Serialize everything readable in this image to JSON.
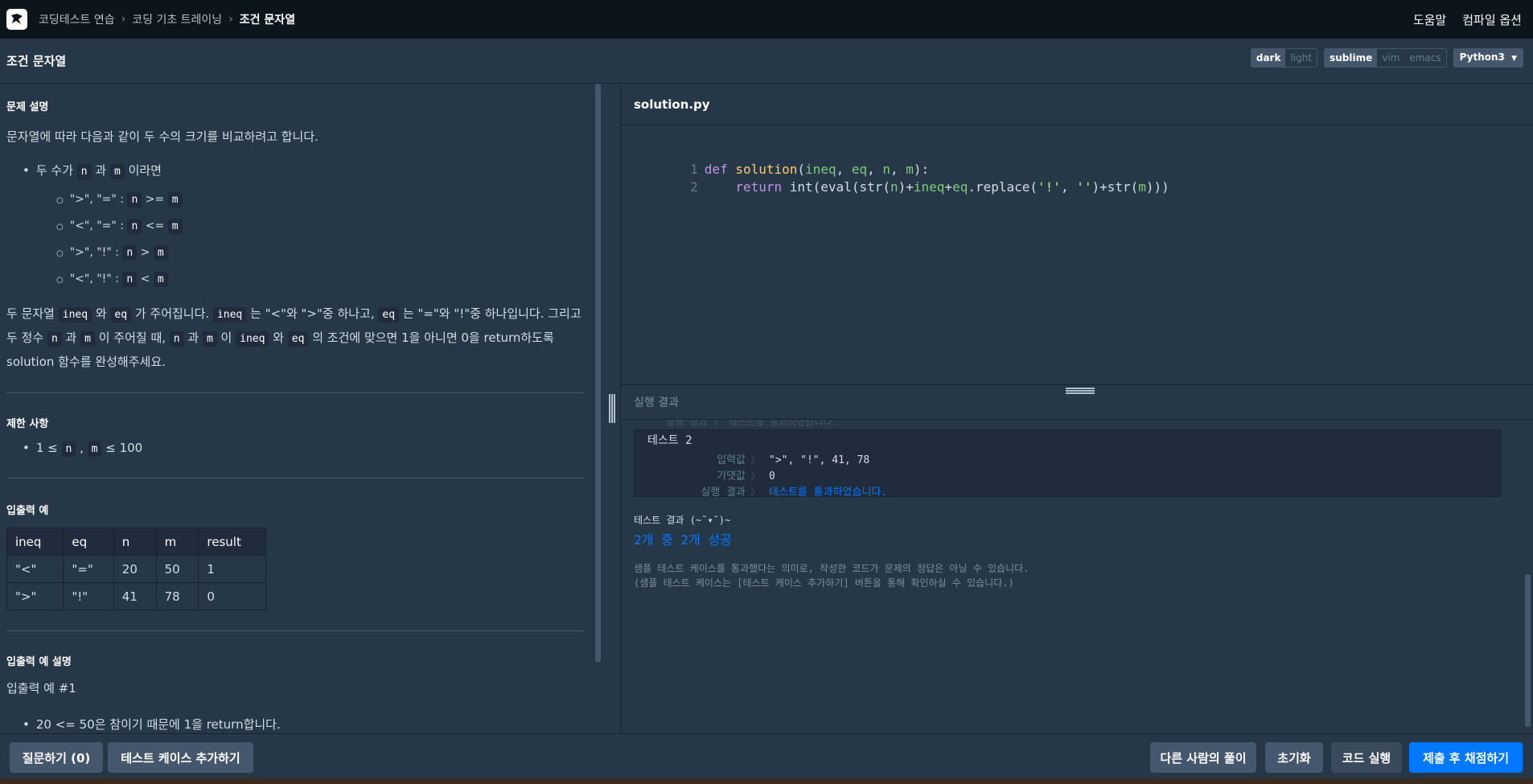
{
  "nav": {
    "crumbs": [
      "코딩테스트 연습",
      "코딩 기초 트레이닝",
      "조건 문자열"
    ],
    "help": "도움말",
    "compile_options": "컴파일 옵션"
  },
  "titlebar": {
    "title": "조건 문자열",
    "theme": {
      "dark": "dark",
      "light": "light"
    },
    "keymap": {
      "sublime": "sublime",
      "vim": "vim",
      "emacs": "emacs"
    },
    "language": "Python3"
  },
  "problem": {
    "desc_heading": "문제 설명",
    "intro": "문자열에 따라 다음과 같이 두 수의 크기를 비교하려고 합니다.",
    "bullet_pre": "두 수가 ",
    "bullet_n": "n",
    "bullet_mid": " 과 ",
    "bullet_m": "m",
    "bullet_post": " 이라면",
    "cases": [
      {
        "label": "\">\", \"=\" : ",
        "a": "n",
        "op": " >= ",
        "b": "m"
      },
      {
        "label": "\"<\", \"=\" : ",
        "a": "n",
        "op": " <= ",
        "b": "m"
      },
      {
        "label": "\">\", \"!\" : ",
        "a": "n",
        "op": " > ",
        "b": "m"
      },
      {
        "label": "\"<\", \"!\" : ",
        "a": "n",
        "op": " < ",
        "b": "m"
      }
    ],
    "para": {
      "p1": "두 문자열 ",
      "c1": "ineq",
      "p2": " 와 ",
      "c2": "eq",
      "p3": " 가 주어집니다. ",
      "c3": "ineq",
      "p4": " 는 \"<\"와 \">\"중 하나고, ",
      "c4": "eq",
      "p5": " 는 \"=\"와 \"!\"중 하나입니다. 그리고 두 정수 ",
      "c5": "n",
      "p6": " 과 ",
      "c6": "m",
      "p7": " 이 주어질 때, ",
      "c7": "n",
      "p8": " 과 ",
      "c8": "m",
      "p9": " 이 ",
      "c9": "ineq",
      "p10": " 와 ",
      "c10": "eq",
      "p11": " 의 조건에 맞으면 1을 아니면 0을 return하도록 solution 함수를 완성해주세요."
    },
    "limits_heading": "제한 사항",
    "limit_pre": "1 ≤ ",
    "limit_n": "n",
    "limit_sep": " , ",
    "limit_m": "m",
    "limit_post": " ≤ 100",
    "io_heading": "입출력 예",
    "table": {
      "headers": [
        "ineq",
        "eq",
        "n",
        "m",
        "result"
      ],
      "rows": [
        [
          "\"<\"",
          "\"=\"",
          "20",
          "50",
          "1"
        ],
        [
          "\">\"",
          "\"!\"",
          "41",
          "78",
          "0"
        ]
      ]
    },
    "io_desc_heading": "입출력 예 설명",
    "example1": "입출력 예 #1",
    "example1_bullet": "20 <= 50은 참이기 때문에 1을 return합니다."
  },
  "editor": {
    "filename": "solution.py",
    "line_numbers": [
      "1",
      "2"
    ],
    "line1": {
      "kw": "def",
      "fn": "solution",
      "open": "(",
      "p1": "ineq",
      "s1": ", ",
      "p2": "eq",
      "s2": ", ",
      "p3": "n",
      "s3": ", ",
      "p4": "m",
      "close": "):"
    },
    "line2": {
      "indent": "    ",
      "kw": "return",
      "t1": " int(eval(str(",
      "v1": "n",
      "t2": ")+",
      "v2": "ineq",
      "t3": "+",
      "v3": "eq",
      "t4": ".replace(",
      "s1": "'!'",
      "t5": ", ",
      "s2": "''",
      "t6": ")+str(",
      "v4": "m",
      "t7": ")))"
    }
  },
  "results": {
    "heading": "실행 결과",
    "clipped_line": "실행 결과 〉 테스트를 통과하였습니다.",
    "test_title": "테스트 2",
    "input_label": "입력값",
    "input_value": "\">\", \"!\", 41, 78",
    "expected_label": "기댓값",
    "expected_value": "0",
    "result_label": "실행 결과",
    "result_value": "테스트를 통과하였습니다.",
    "arrow": "〉",
    "summary_label": "테스트 결과 (~˘▾˘)~",
    "summary_value": "2개 중 2개 성공",
    "note1": "샘플 테스트 케이스를 통과했다는 의미로, 작성한 코드가 문제의 정답은 아닐 수 있습니다.",
    "note2": "(샘플 테스트 케이스는 [테스트 케이스 추가하기] 버튼을 통해 확인하실 수 있습니다.)"
  },
  "buttons": {
    "ask": "질문하기 (0)",
    "add_test": "테스트 케이스 추가하기",
    "others": "다른 사람의 풀이",
    "reset": "초기화",
    "run": "코드 실행",
    "submit": "제출 후 채점하기"
  },
  "colors": {
    "accent": "#0078ff",
    "background": "#263747",
    "topnav": "#0c151c"
  }
}
